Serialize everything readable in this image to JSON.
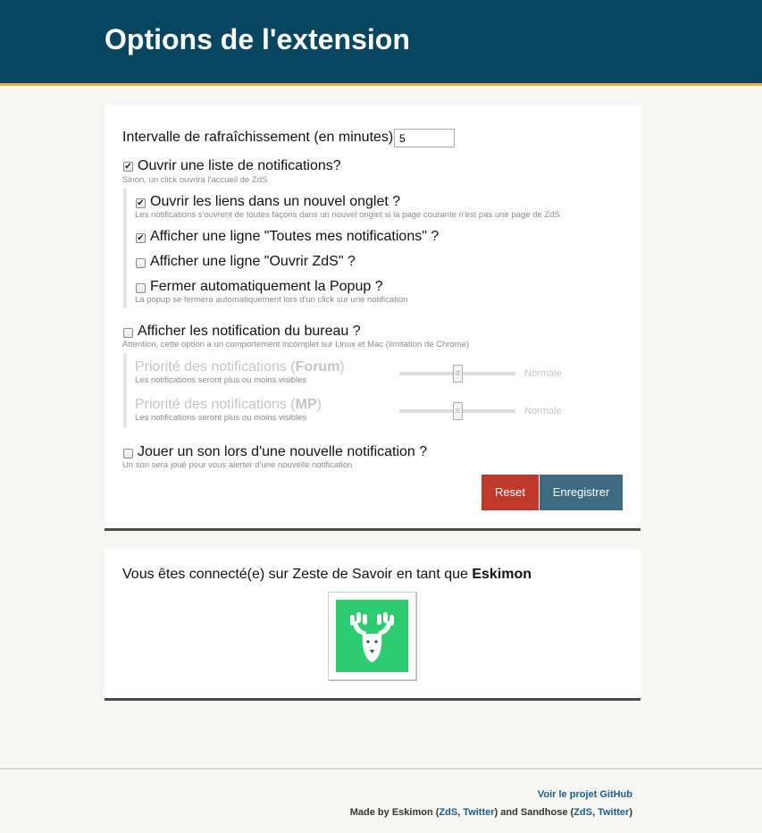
{
  "header": {
    "title": "Options de l'extension"
  },
  "options": {
    "interval_label": "Intervalle de rafraîchissement (en minutes)",
    "interval_value": "5",
    "open_list": {
      "label": "Ouvrir une liste de notifications?",
      "hint": "Sinon, un click ouvrira l'accueil de ZdS",
      "checked": true
    },
    "new_tab": {
      "label": "Ouvrir les liens dans un nouvel onglet ?",
      "hint": "Les notifications s'ouvrent de toutes façons dans un nouvel onglet si la page courante n'est pas une page de ZdS",
      "checked": true
    },
    "all_notifs": {
      "label": "Afficher une ligne \"Toutes mes notifications\" ?",
      "checked": true
    },
    "open_zds": {
      "label": "Afficher une ligne \"Ouvrir ZdS\" ?",
      "checked": false
    },
    "auto_close": {
      "label": "Fermer automatiquement la Popup ?",
      "hint": "La popup se fermera automatiquement lors d'un click sur une notification",
      "checked": false
    },
    "desktop": {
      "label": "Afficher les notification du bureau ?",
      "hint": "Attention, cette option a un comportement incomplet sur Linux et Mac (limitation de Chrome)",
      "checked": false
    },
    "priority_forum": {
      "label_prefix": "Priorité des notifications (",
      "label_bold": "Forum",
      "label_suffix": ")",
      "hint": "Les notifications seront plus ou moins visibles",
      "value_label": "Normale",
      "level": 0.5
    },
    "priority_mp": {
      "label_prefix": "Priorité des notifications (",
      "label_bold": "MP",
      "label_suffix": ")",
      "hint": "Les notifications seront plus ou moins visibles",
      "value_label": "Normale",
      "level": 0.5
    },
    "sound": {
      "label": "Jouer un son lors d'une nouvelle notification ?",
      "hint": "Un son sera joué pour vous alerter d'une nouvelle notification",
      "checked": false
    },
    "reset_label": "Reset",
    "save_label": "Enregistrer"
  },
  "account": {
    "text_prefix": "Vous êtes connecté(e) sur Zeste de Savoir en tant que ",
    "username": "Eskimon",
    "avatar_color": "#2ecc71"
  },
  "footer": {
    "github_link": "Voir le projet GitHub",
    "made_by_prefix": "Made by Eskimon (",
    "eskimon_zds": "ZdS",
    "sep1": ", ",
    "eskimon_twitter": "Twitter",
    "middle": ") and Sandhose (",
    "sandhose_zds": "ZdS",
    "sep2": ", ",
    "sandhose_twitter": "Twitter",
    "suffix": ")"
  },
  "colors": {
    "header_bg": "#084561",
    "header_accent": "#f8ad32",
    "reset": "#c0392b",
    "save": "#3e6b82",
    "link": "#1a5e86"
  }
}
